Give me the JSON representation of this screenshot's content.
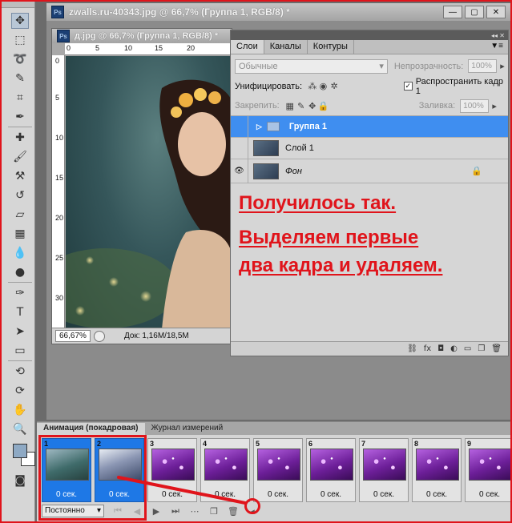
{
  "document_window": {
    "title": "zwalls.ru-40343.jpg @ 66,7% (Группа 1, RGB/8) *",
    "ps_badge": "Ps",
    "minimize": "—",
    "restore": "▢",
    "close": "✕"
  },
  "image_window": {
    "title": "д.jpg @ 66,7% (Группа 1, RGB/8) *",
    "ps_badge": "Ps",
    "ruler_h": [
      "0",
      "5",
      "10",
      "15",
      "20"
    ],
    "ruler_v": [
      "0",
      "5",
      "10",
      "15",
      "20",
      "25",
      "30"
    ],
    "zoom": "66,67%",
    "doc_info": "Док: 1,16M/18,5M"
  },
  "layers_panel": {
    "tabs": [
      "Слои",
      "Каналы",
      "Контуры"
    ],
    "menu_icon": "▼≡",
    "blend_mode": "Обычные",
    "opacity_label": "Непрозрачность:",
    "opacity_value": "100%",
    "unify_label": "Унифицировать:",
    "propagate_label": "Распространить кадр 1",
    "lock_label": "Закрепить:",
    "fill_label": "Заливка:",
    "fill_value": "100%",
    "layers": [
      {
        "name": "Группа 1",
        "type": "group",
        "selected": true
      },
      {
        "name": "Слой 1",
        "type": "layer",
        "selected": false
      },
      {
        "name": "Фон",
        "type": "background",
        "selected": false
      }
    ],
    "note_lines": [
      "Получилось так.",
      "Выделяем первые",
      "два кадра и удаляем."
    ]
  },
  "animation_panel": {
    "tabs": [
      "Анимация (покадровая)",
      "Журнал измерений"
    ],
    "frames": [
      {
        "num": "1",
        "time": "0 сек.",
        "thumb": "girl",
        "selected": true
      },
      {
        "num": "2",
        "time": "0 сек.",
        "thumb": "blue",
        "selected": true
      },
      {
        "num": "3",
        "time": "0 сек.",
        "thumb": "purple",
        "selected": false
      },
      {
        "num": "4",
        "time": "0 сек.",
        "thumb": "purple",
        "selected": false
      },
      {
        "num": "5",
        "time": "0 сек.",
        "thumb": "purple",
        "selected": false
      },
      {
        "num": "6",
        "time": "0 сек.",
        "thumb": "purple",
        "selected": false
      },
      {
        "num": "7",
        "time": "0 сек.",
        "thumb": "purple",
        "selected": false
      },
      {
        "num": "8",
        "time": "0 сек.",
        "thumb": "purple",
        "selected": false
      },
      {
        "num": "9",
        "time": "0 сек.",
        "thumb": "purple",
        "selected": false
      }
    ],
    "loop": "Постоянно"
  },
  "colors": {
    "annotation_red": "#e0141b",
    "selection_blue": "#3f8ef0",
    "foreground_swatch": "#8ea9c4"
  }
}
